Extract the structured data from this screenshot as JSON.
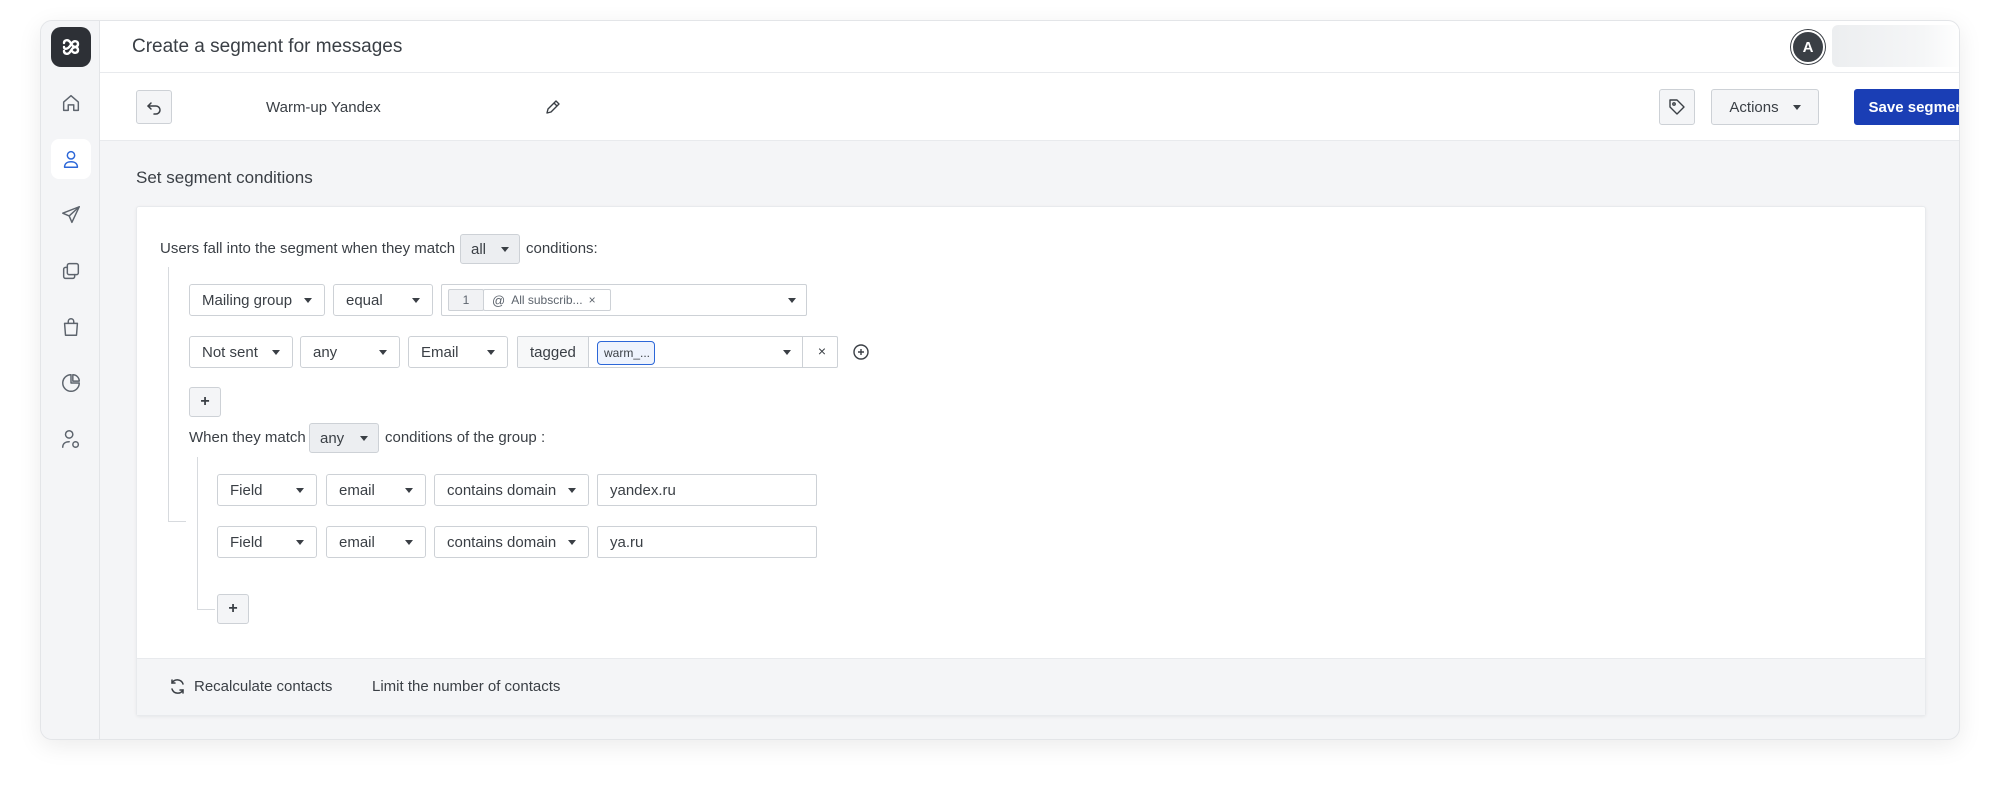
{
  "header": {
    "title": "Create a segment for messages",
    "avatar_initial": "A"
  },
  "toolbar": {
    "segment_name": "Warm-up Yandex",
    "actions_label": "Actions",
    "save_label": "Save segment"
  },
  "section": {
    "title": "Set segment conditions"
  },
  "conditions": {
    "intro_prefix": "Users fall into the segment when they match",
    "match_value": "all",
    "intro_suffix": "conditions:",
    "row1": {
      "field": "Mailing group",
      "operator": "equal",
      "chip_count": "1",
      "chip_label": "All subscrib...",
      "chip_remove": "×"
    },
    "row2": {
      "field": "Not sent",
      "quantifier": "any",
      "channel": "Email",
      "tag_prefix": "tagged",
      "tag_chip": "warm_...",
      "remove": "×"
    },
    "add_label": "+",
    "group": {
      "prefix": "When they match",
      "match_value": "any",
      "suffix": "conditions of the group :",
      "rows": [
        {
          "type": "Field",
          "field": "email",
          "operator": "contains domain",
          "value": "yandex.ru"
        },
        {
          "type": "Field",
          "field": "email",
          "operator": "contains domain",
          "value": "ya.ru"
        }
      ],
      "add_label": "+"
    }
  },
  "footer": {
    "recalculate": "Recalculate contacts",
    "limit": "Limit the number of contacts"
  },
  "colors": {
    "primary": "#1a3eb5",
    "active_nav": "#2c67d8",
    "logo_bg": "#2d3036"
  },
  "nav": {
    "items": [
      "home-icon",
      "user-icon",
      "send-icon",
      "copy-icon",
      "shopping-bag-icon",
      "pie-chart-icon",
      "user-settings-icon"
    ],
    "active": "user-icon"
  }
}
